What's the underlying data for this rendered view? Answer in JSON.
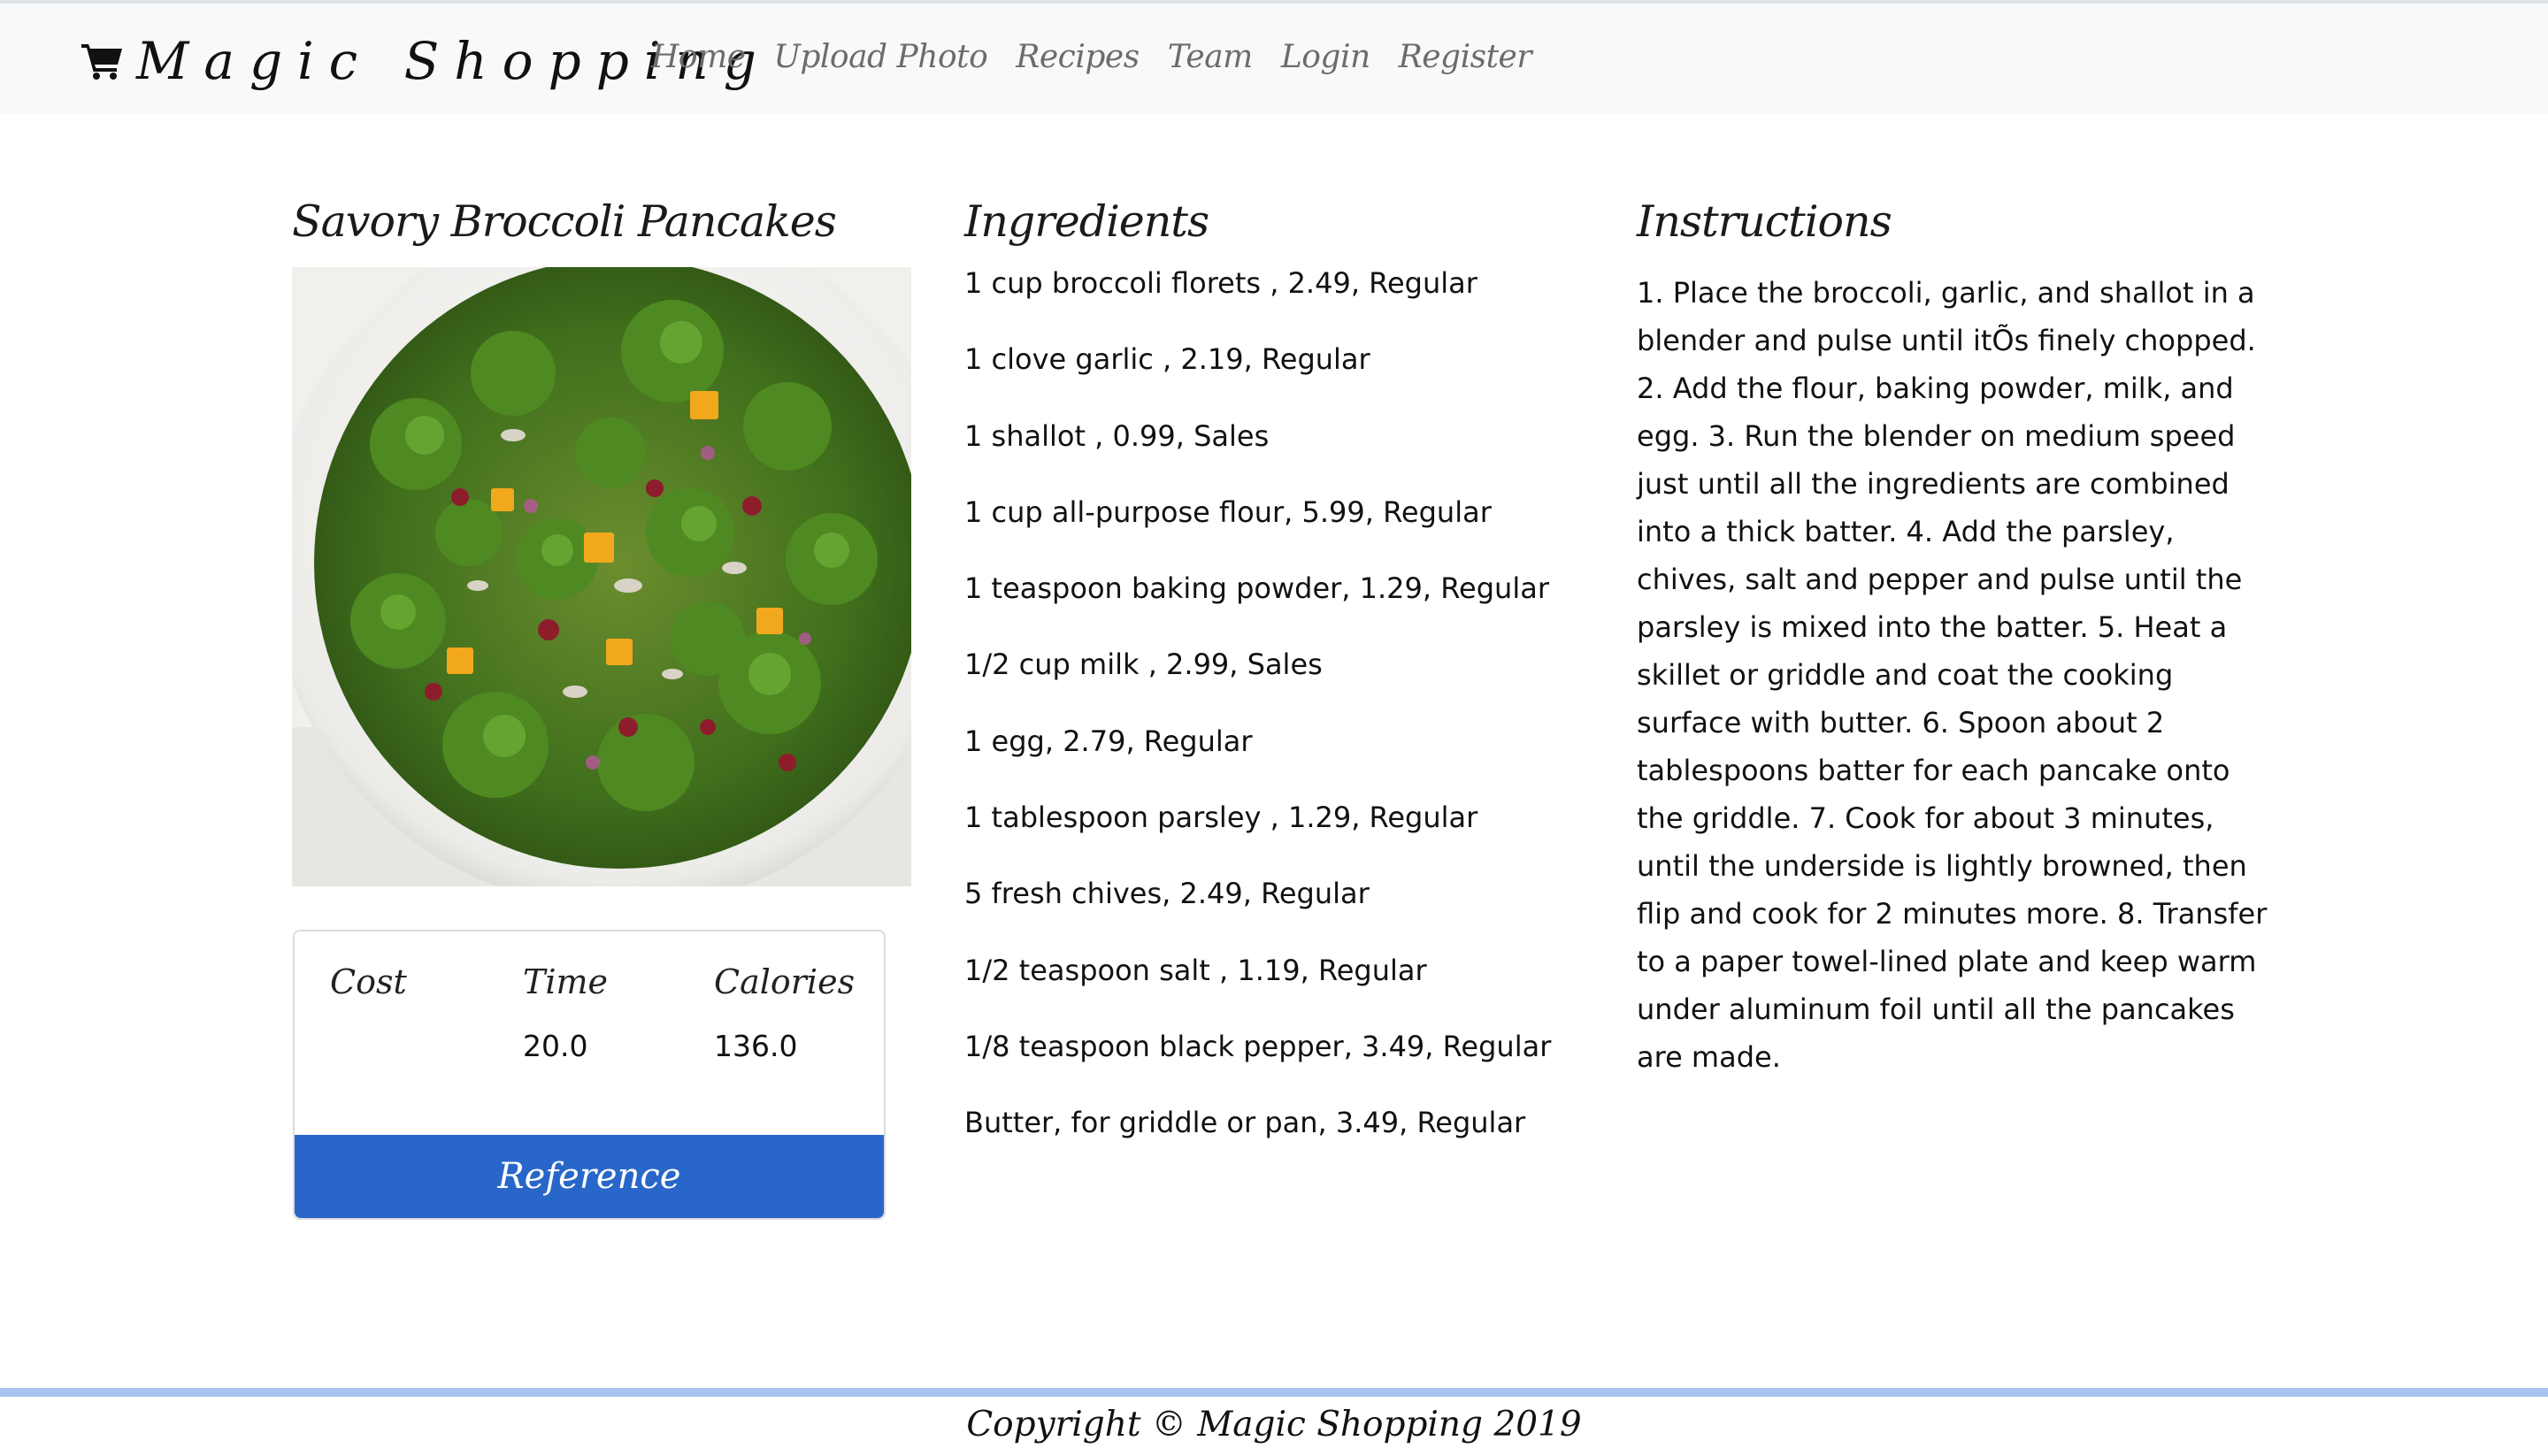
{
  "navbar": {
    "brand": "Magic Shopping",
    "brand_icon": "shopping-cart-icon",
    "links": [
      "Home",
      "Upload Photo",
      "Recipes",
      "Team",
      "Login",
      "Register"
    ]
  },
  "recipe": {
    "title": "Savory Broccoli Pancakes",
    "image_alt": "broccoli salad with cheese, cranberries and red onion in a white bowl",
    "stats": {
      "cost_label": "Cost",
      "time_label": "Time",
      "calories_label": "Calories",
      "cost_value": "",
      "time_value": "20.0",
      "calories_value": "136.0"
    },
    "reference_label": "Reference"
  },
  "ingredients": {
    "heading": "Ingredients",
    "items": [
      "1 cup broccoli florets , 2.49, Regular",
      "1 clove garlic , 2.19, Regular",
      "1 shallot , 0.99, Sales",
      "1 cup all-purpose flour, 5.99, Regular",
      "1 teaspoon baking powder, 1.29, Regular",
      "1/2 cup milk , 2.99, Sales",
      "1 egg, 2.79, Regular",
      "1 tablespoon parsley , 1.29, Regular",
      "5 fresh chives, 2.49, Regular",
      "1/2 teaspoon salt , 1.19, Regular",
      "1/8 teaspoon black pepper, 3.49, Regular",
      "Butter, for griddle or pan, 3.49, Regular"
    ]
  },
  "instructions": {
    "heading": "Instructions",
    "text": "1. Place the broccoli, garlic, and shallot in a blender and pulse until itÕs finely chopped. 2. Add the flour, baking powder, milk, and egg. 3. Run the blender on medium speed just until all the ingredients are combined into a thick batter. 4. Add the parsley, chives, salt and pepper and pulse until the parsley is mixed into the batter. 5. Heat a skillet or griddle and coat the cooking surface with butter. 6. Spoon about 2 tablespoons batter for each pancake onto the griddle. 7. Cook for about 3 minutes, until the underside is lightly browned, then flip and cook for 2 minutes more. 8. Transfer to a paper towel-lined plate and keep warm under aluminum foil until all the pancakes are made."
  },
  "footer": {
    "copyright": "Copyright © Magic Shopping 2019"
  },
  "colors": {
    "navbar_bg": "#f8f9fa",
    "button_blue": "#2867c9",
    "footer_rule": "#a8c4ee",
    "nav_link": "#6c6c6c"
  }
}
